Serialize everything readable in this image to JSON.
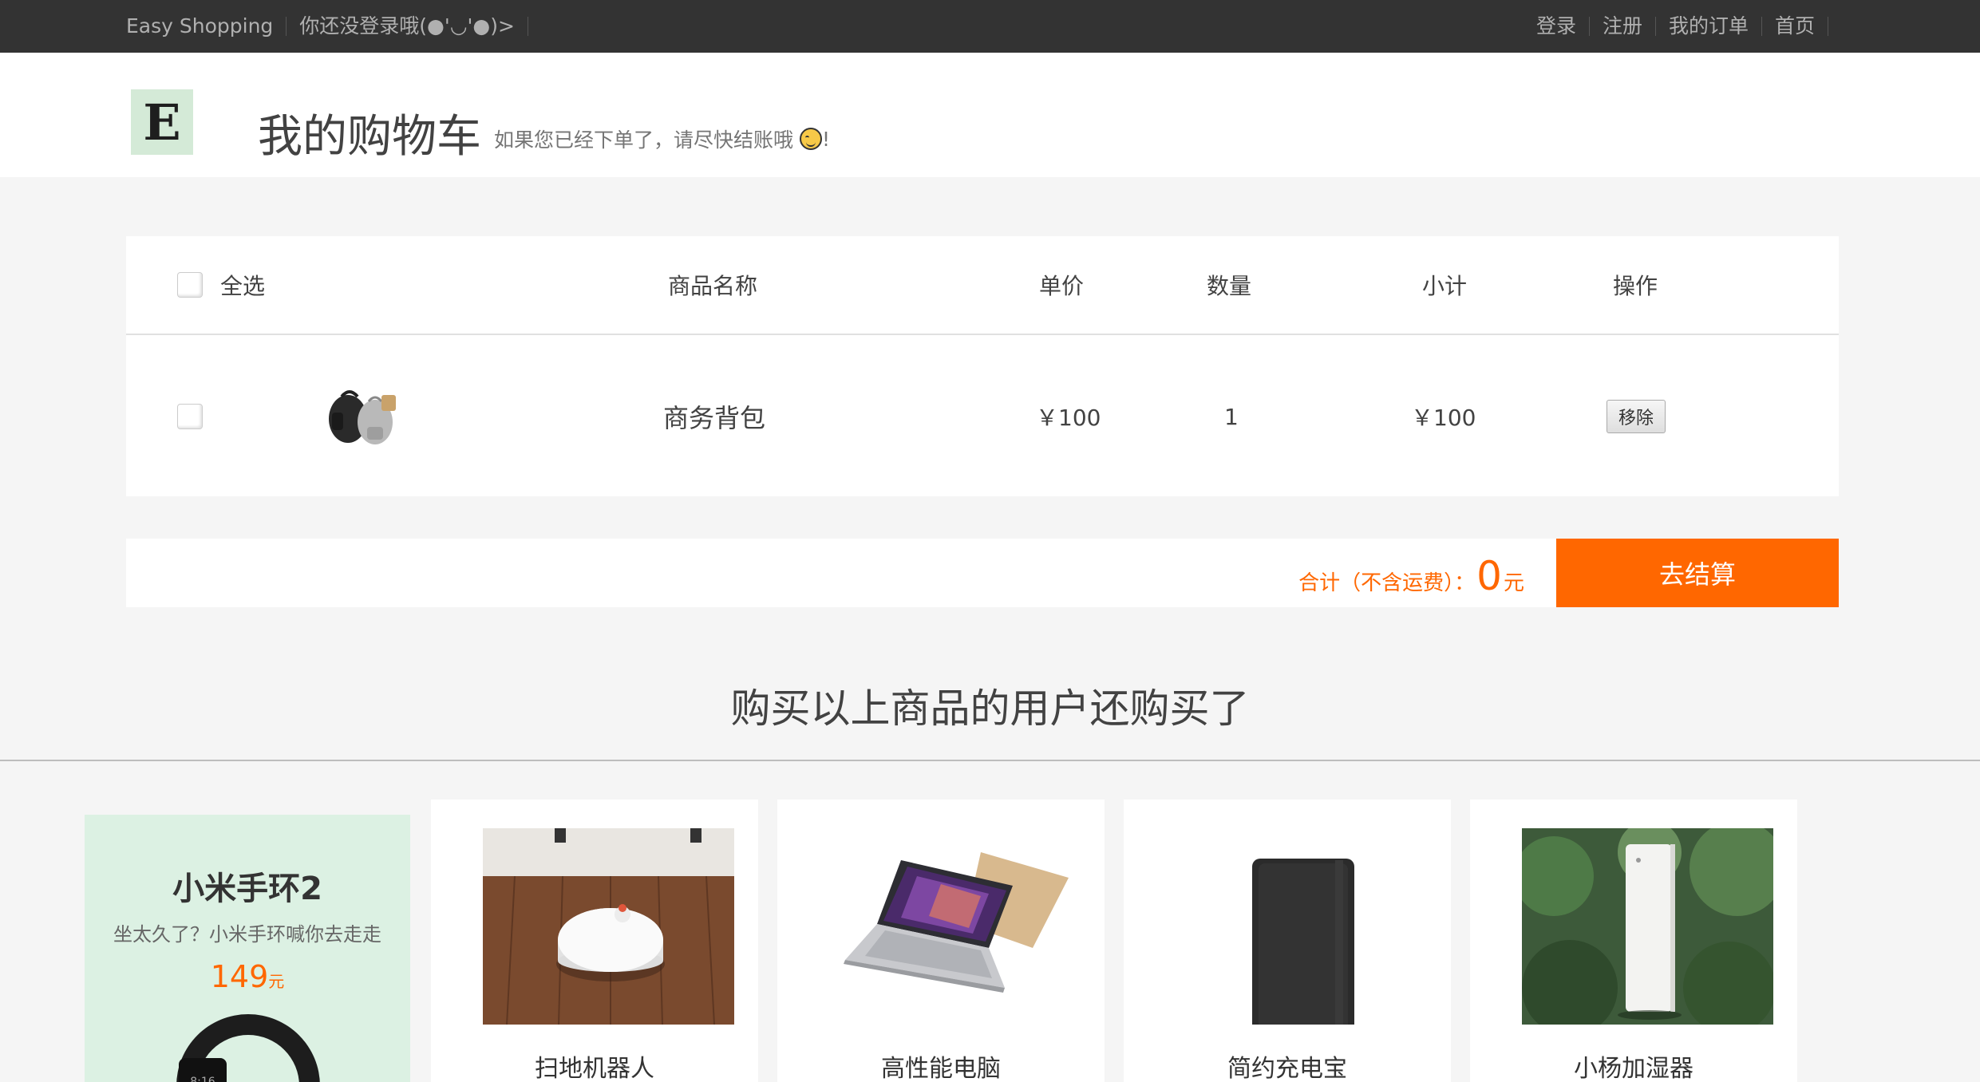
{
  "topbar": {
    "brand": "Easy Shopping",
    "login_status": "你还没登录哦(●'◡'●)>",
    "links": [
      "登录",
      "注册",
      "我的订单",
      "首页"
    ]
  },
  "header": {
    "logo_letter": "E",
    "title": "我的购物车",
    "subtitle": "如果您已经下单了，请尽快结账哦",
    "subtitle_tail": "!"
  },
  "cart": {
    "columns": {
      "select_all": "全选",
      "name": "商品名称",
      "price": "单价",
      "quantity": "数量",
      "subtotal": "小计",
      "action": "操作"
    },
    "items": [
      {
        "name": "商务背包",
        "price": "￥100",
        "quantity": "1",
        "subtotal": "￥100",
        "action": "移除"
      }
    ]
  },
  "total": {
    "label": "合计（不含运费）：",
    "amount": "0",
    "unit": "元",
    "checkout": "去结算"
  },
  "recommend": {
    "title": "购买以上商品的用户还购买了",
    "promo": {
      "name": "小米手环2",
      "desc": "坐太久了？小米手环喊你去走走",
      "price": "149",
      "unit": "元"
    },
    "products": [
      {
        "name": "扫地机器人"
      },
      {
        "name": "高性能电脑"
      },
      {
        "name": "简约充电宝"
      },
      {
        "name": "小杨加湿器"
      }
    ]
  },
  "colors": {
    "accent": "#ff6700",
    "topbar": "#333333",
    "promo_bg": "#dcf1e3"
  }
}
